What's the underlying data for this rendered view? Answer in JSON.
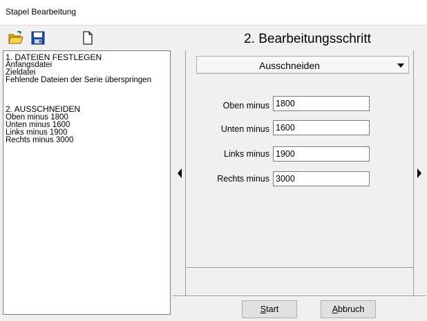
{
  "window": {
    "title": "Stapel Bearbeitung"
  },
  "toolbar": [
    {
      "name": "open-folder-button",
      "icon": "open-folder-icon"
    },
    {
      "name": "save-button",
      "icon": "floppy-disk-icon"
    },
    {
      "name": "new-document-button",
      "icon": "blank-document-icon"
    }
  ],
  "heading": "2. Bearbeitungsschritt",
  "summary": {
    "lines": [
      "1. DATEIEN FESTLEGEN",
      "Anfangsdatei",
      "Zieldatei",
      "Fehlende Dateien der Serie überspringen",
      "",
      "2. AUSSCHNEIDEN",
      "Oben minus  1800",
      "Unten minus  1600",
      "Links minus  1900",
      "Rechts minus  3000"
    ]
  },
  "step_select": {
    "value": "Ausschneiden"
  },
  "fields": [
    {
      "label": "Oben minus",
      "value": "1800"
    },
    {
      "label": "Unten minus",
      "value": "1600"
    },
    {
      "label": "Links minus",
      "value": "1900"
    },
    {
      "label": "Rechts minus",
      "value": "3000"
    }
  ],
  "buttons": {
    "start": {
      "first": "S",
      "rest": "tart"
    },
    "cancel": {
      "first": "A",
      "rest": "bbruch"
    }
  },
  "colors": {
    "folder": "#f2c200",
    "floppy": "#1f4fa8",
    "chrome": "#f0f0f0"
  }
}
